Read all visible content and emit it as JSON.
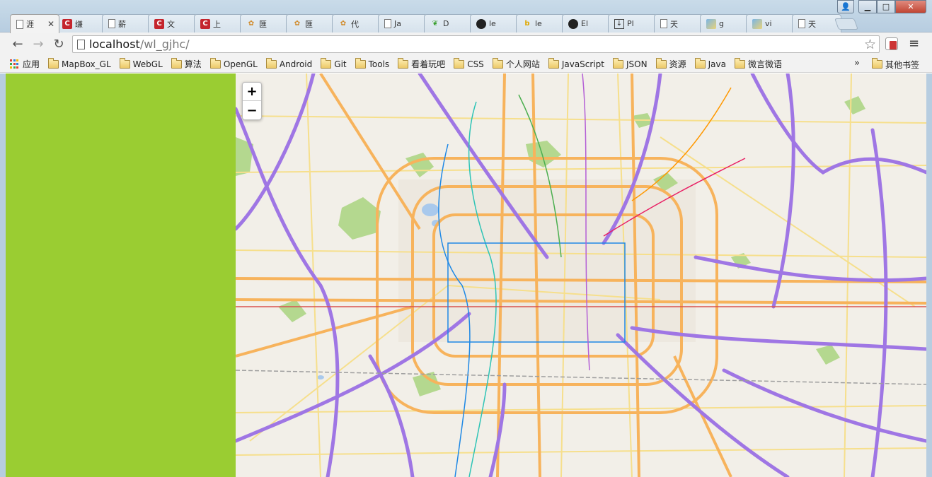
{
  "window": {
    "controls": {
      "user": "👤",
      "minimize": "▁",
      "maximize": "□",
      "close": "✕"
    }
  },
  "tabs": [
    {
      "label": "涯",
      "icon": "document-icon",
      "active": true
    },
    {
      "label": "缣",
      "icon": "csdn-icon"
    },
    {
      "label": "薪",
      "icon": "document-icon"
    },
    {
      "label": "文",
      "icon": "csdn-icon"
    },
    {
      "label": "上",
      "icon": "csdn-icon"
    },
    {
      "label": "匯",
      "icon": "orange-globe-icon"
    },
    {
      "label": "匯",
      "icon": "orange-globe-icon"
    },
    {
      "label": "代",
      "icon": "orange-globe-icon"
    },
    {
      "label": "Ja",
      "icon": "document-icon"
    },
    {
      "label": "D",
      "icon": "leaf-icon"
    },
    {
      "label": "le",
      "icon": "github-icon"
    },
    {
      "label": "le",
      "icon": "bing-icon"
    },
    {
      "label": "El",
      "icon": "github-icon"
    },
    {
      "label": "Pl",
      "icon": "download-icon"
    },
    {
      "label": "天",
      "icon": "document-icon"
    },
    {
      "label": "g",
      "icon": "image-icon"
    },
    {
      "label": "vi",
      "icon": "image-icon"
    },
    {
      "label": "天",
      "icon": "document-icon"
    }
  ],
  "toolbar": {
    "back": "←",
    "forward": "→",
    "reload": "↻",
    "url_host": "localhost",
    "url_path": "/wl_gjhc/",
    "star": "☆",
    "menu": "≡"
  },
  "bookmarks": {
    "apps_label": "应用",
    "items": [
      "MapBox_GL",
      "WebGL",
      "算法",
      "OpenGL",
      "Android",
      "Git",
      "Tools",
      "看着玩吧",
      "CSS",
      "个人网站",
      "JavaScript",
      "JSON",
      "资源",
      "Java",
      "微言微语"
    ],
    "more": "»",
    "other_label": "其他书签"
  },
  "map": {
    "zoom_in": "+",
    "zoom_out": "−",
    "colors": {
      "sidebar": "#9acd32",
      "highway": "#9f76e4",
      "arterial": "#f7b35c",
      "minor": "#f6df8c",
      "park": "#a9d37f",
      "water": "#a9c9ec",
      "background": "#f2efe8"
    }
  }
}
